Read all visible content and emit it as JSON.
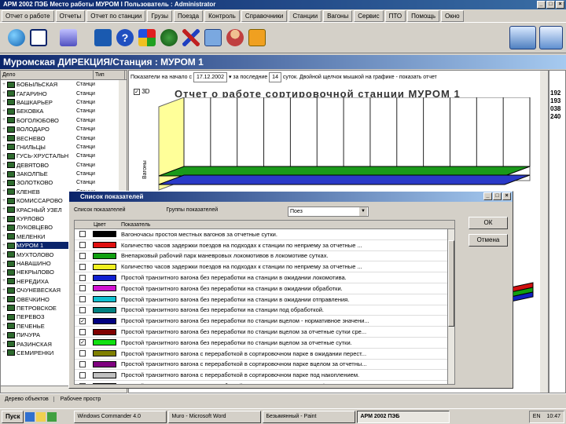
{
  "window": {
    "title": "АРМ 2002 ПЭБ   Место работы МУРОМ I   Пользователь : Administrator"
  },
  "menu": [
    "Отчет о работе",
    "Отчеты",
    "Отчет по станции",
    "Грузы",
    "Поезда",
    "Контроль",
    "Справочники",
    "Станции",
    "Вагоны",
    "Сервис",
    "ПТО",
    "Помощь",
    "Окно"
  ],
  "toolbar": {
    "icons": [
      "globe-icon",
      "window-icon",
      "export-icon",
      "book-icon",
      "help-icon",
      "windows-logo-icon",
      "network-globe-icon",
      "tools-icon",
      "computers-icon",
      "users-icon",
      "exit-icon"
    ]
  },
  "header": {
    "title": "Муромская ДИРЕКЦИЯ/Станция : МУРОМ 1"
  },
  "station_list": {
    "col_name": "Дело",
    "col_type": "Тип",
    "items": [
      {
        "name": "БОБЫЛЬСКАЯ",
        "type": "Станци"
      },
      {
        "name": "ГАГАРИНО",
        "type": "Станци"
      },
      {
        "name": "ВАШКАРЬЕР",
        "type": "Станци"
      },
      {
        "name": "БЕКОВКА",
        "type": "Станци"
      },
      {
        "name": "БОГОЛЮБОВО",
        "type": "Станци"
      },
      {
        "name": "ВОЛОДАРО",
        "type": "Станци"
      },
      {
        "name": "ВЕСНЕВО",
        "type": "Станци"
      },
      {
        "name": "ГНИЛЬЦЫ",
        "type": "Станци"
      },
      {
        "name": "ГУСЬ-ХРУСТАЛЬН",
        "type": "Станци"
      },
      {
        "name": "ДЕВЯТОВО",
        "type": "Станци"
      },
      {
        "name": "ЗАКОЛПЬЕ",
        "type": "Станци"
      },
      {
        "name": "ЗОЛОТКОВО",
        "type": "Станци"
      },
      {
        "name": "КЛЕНЕВ",
        "type": "Станци"
      },
      {
        "name": "КОМИССАРОВО",
        "type": "Станци"
      },
      {
        "name": "КРАСНЫЙ УЗЕЛ",
        "type": "Станци"
      },
      {
        "name": "КУРЛОВО",
        "type": "Станци"
      },
      {
        "name": "ЛУКОВЦЕВО",
        "type": "Станци"
      },
      {
        "name": "МЕЛЕНКИ",
        "type": "Станци"
      },
      {
        "name": "МУРОМ 1",
        "type": "Станци"
      },
      {
        "name": "МУХТОЛОВО",
        "type": "Станци"
      },
      {
        "name": "НАВАШИНО",
        "type": "Станци"
      },
      {
        "name": "НЕКРЫЛОВО",
        "type": "Станци"
      },
      {
        "name": "НЕРЕДИХА",
        "type": "Станци"
      },
      {
        "name": "ОЧУНЕВЕСКАЯ",
        "type": "Станци"
      },
      {
        "name": "ОВЕЧКИНО",
        "type": "Станци"
      },
      {
        "name": "ПЕТРОВСКОЕ",
        "type": "Станци"
      },
      {
        "name": "ПЕРЕВОЗ",
        "type": "Станци"
      },
      {
        "name": "ПЕЧЕНЬЕ",
        "type": "Станци"
      },
      {
        "name": "ПИЧУРА",
        "type": "Станци"
      },
      {
        "name": "РАЗИНСКАЯ",
        "type": "Станци"
      },
      {
        "name": "СЕМИРЕНКИ",
        "type": "Станци"
      }
    ]
  },
  "params": {
    "label_date": "Показатели на начало с",
    "date": "17.12.2002",
    "label_period": "за последние",
    "days": "14",
    "label_rest": "суток. Двойной щелчок мышкой на графике - показать отчет"
  },
  "report": {
    "checkbox_3d": "3D",
    "title": "Отчет о работе сортировочной станции МУРОМ 1",
    "ylabel": "Вагоны"
  },
  "side_values": [
    "192",
    "193",
    "038",
    "240"
  ],
  "dialog": {
    "title": "Список показателей",
    "label_list": "Список показателей",
    "label_groups": "Группы показателей",
    "group_value": "Поез",
    "ok": "ОК",
    "cancel": "Отмена",
    "col_color": "Цвет",
    "col_indicator": "Показатель",
    "rows": [
      {
        "checked": false,
        "color": "#000000",
        "text": "Вагоночасы простоя местных вагонов за отчетные сутки."
      },
      {
        "checked": false,
        "color": "#e01010",
        "text": "Количество часов задержки поездов на подходах к станции по неприему за отчетные ..."
      },
      {
        "checked": false,
        "color": "#10a010",
        "text": "Внепарковый рабочий парк маневровых локомотивов в локомотиве сутках."
      },
      {
        "checked": false,
        "color": "#f0f020",
        "text": "Количество часов задержки поездов на подходах к станции по неприему за отчетные ..."
      },
      {
        "checked": false,
        "color": "#1020d0",
        "text": "Простой транзитного вагона без переработки на станции в ожидании локомотива."
      },
      {
        "checked": false,
        "color": "#d010d0",
        "text": "Простой транзитного вагона без переработки на станции в ожидании обработки."
      },
      {
        "checked": false,
        "color": "#10c0d0",
        "text": "Простой транзитного вагона без переработки на станции в ожидании отправления."
      },
      {
        "checked": false,
        "color": "#008080",
        "text": "Простой транзитного вагона без переработки на станции под обработкой."
      },
      {
        "checked": true,
        "color": "#000080",
        "text": "Простой транзитного вагона без переработки по станции вцелом - нормативное значени..."
      },
      {
        "checked": false,
        "color": "#800000",
        "text": "Простой транзитного вагона без переработки по станции вцелом за отчетные сутки сре..."
      },
      {
        "checked": true,
        "color": "#10e010",
        "text": "Простой транзитного вагона без переработки по станции вцелом за отчетные сутки."
      },
      {
        "checked": false,
        "color": "#808000",
        "text": "Простой транзитного вагона с переработкой в сортировочном парке в ожидании перест..."
      },
      {
        "checked": false,
        "color": "#800080",
        "text": "Простой транзитного вагона с переработкой в сортировочном парке вцелом за отчетны..."
      },
      {
        "checked": false,
        "color": "#c0c0c0",
        "text": "Простой транзитного вагона с переработкой в сортировочном парке под накоплением."
      },
      {
        "checked": false,
        "color": "#40e0f0",
        "text": "Простой транзитного вагона с переработкой в сортировочном парке под формированием"
      },
      {
        "checked": false,
        "color": "#000000",
        "text": "Простой транзитного вагона с переработкой по прибытии в ожидании обработки."
      }
    ]
  },
  "bottom_tabs": [
    "Дерево объектов",
    "Рабочее простр"
  ],
  "taskbar": {
    "start": "Пуск",
    "tasks": [
      "Windows Commander 4.0",
      "Muro - Microsoft Word",
      "Безымянный - Paint",
      "АРМ 2002 ПЭБ"
    ],
    "tray_lang": "EN",
    "time": "10:47"
  },
  "colors": {
    "accent": "#0a246a",
    "chart_yellow": "#ffff99",
    "bar_green": "#1a9a1a",
    "bar_blue": "#2a3ac8"
  }
}
